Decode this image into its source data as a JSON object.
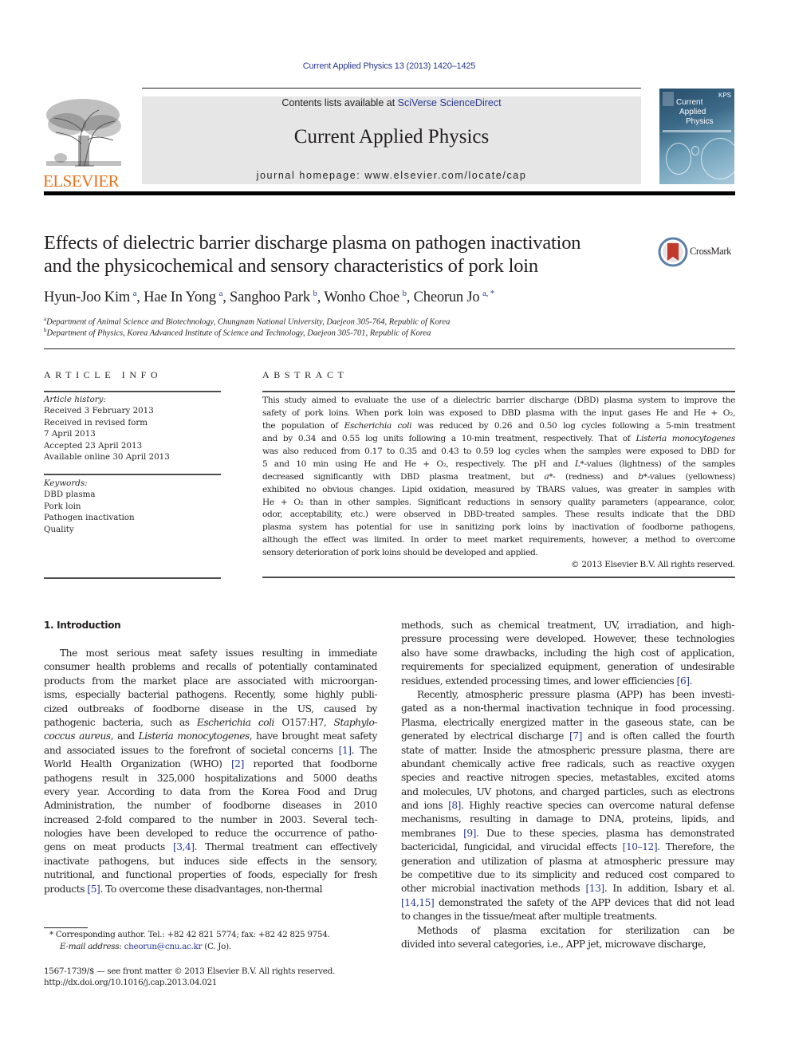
{
  "running_head": "Current Applied Physics 13 (2013) 1420–1425",
  "publisher": {
    "logo_text": "ELSEVIER",
    "logo_icon": "elsevier-tree-icon",
    "brand_color": "#e9711c"
  },
  "banner": {
    "contents_prefix": "Contents lists available at ",
    "contents_link": "SciVerse ScienceDirect",
    "journal_title": "Current Applied Physics",
    "homepage": "journal homepage: www.elsevier.com/locate/cap",
    "background": "#e6e6e6",
    "link_color": "#2b3990"
  },
  "cover": {
    "line1": "Current",
    "line2": "Applied",
    "line3": "Physics",
    "badge": "KPS"
  },
  "article": {
    "title_line1": "Effects of dielectric barrier discharge plasma on pathogen inactivation",
    "title_line2": "and the physicochemical and sensory characteristics of pork loin",
    "crossmark_label": "CrossMark",
    "authors": [
      {
        "name": "Hyun-Joo Kim",
        "sup": "a"
      },
      {
        "name": "Hae In Yong",
        "sup": "a"
      },
      {
        "name": "Sanghoo Park",
        "sup": "b"
      },
      {
        "name": "Wonho Choe",
        "sup": "b"
      },
      {
        "name": "Cheorun Jo",
        "sup": "a, *"
      }
    ],
    "affiliations": [
      {
        "sup": "a",
        "text": "Department of Animal Science and Biotechnology, Chungnam National University, Daejeon 305-764, Republic of Korea"
      },
      {
        "sup": "b",
        "text": "Department of Physics, Korea Advanced Institute of Science and Technology, Daejeon 305-701, Republic of Korea"
      }
    ]
  },
  "article_info": {
    "heading": "ARTICLE INFO",
    "history_label": "Article history:",
    "history": [
      "Received 3 February 2013",
      "Received in revised form",
      "7 April 2013",
      "Accepted 23 April 2013",
      "Available online 30 April 2013"
    ],
    "keywords_label": "Keywords:",
    "keywords": [
      "DBD plasma",
      "Pork loin",
      "Pathogen inactivation",
      "Quality"
    ]
  },
  "abstract": {
    "heading": "ABSTRACT",
    "lines": [
      "This study aimed to evaluate the use of a dielectric barrier discharge (DBD) plasma system to improve the",
      "safety of pork loins. When pork loin was exposed to DBD plasma with the input gases He and He + O₂,",
      "the population of Escherichia coli was reduced by 0.26 and 0.50 log cycles following a 5-min treatment",
      "and by 0.34 and 0.55 log units following a 10-min treatment, respectively. That of Listeria monocytogenes",
      "was also reduced from 0.17 to 0.35 and 0.43 to 0.59 log cycles when the samples were exposed to DBD for",
      "5 and 10 min using He and He + O₂, respectively. The pH and L*-values (lightness) of the samples",
      "decreased significantly with DBD plasma treatment, but a*- (redness) and b*-values (yellowness)",
      "exhibited no obvious changes. Lipid oxidation, measured by TBARS values, was greater in samples with",
      "He + O₂ than in other samples. Significant reductions in sensory quality parameters (appearance, color,",
      "odor, acceptability, etc.) were observed in DBD-treated samples. These results indicate that the DBD",
      "plasma system has potential for use in sanitizing pork loins by inactivation of foodborne pathogens,",
      "although the effect was limited. In order to meet market requirements, however, a method to overcome",
      "sensory deterioration of pork loins should be developed and applied."
    ],
    "copyright": "© 2013 Elsevier B.V. All rights reserved."
  },
  "introduction": {
    "heading": "1.  Introduction",
    "left_column": [
      "The most serious meat safety issues resulting in immediate",
      "consumer health problems and recalls of potentially contaminated",
      "products from the market place are associated with microorgan-",
      "isms, especially bacterial pathogens. Recently, some highly publi-",
      "cized outbreaks of foodborne disease in the US, caused by",
      "pathogenic bacteria, such as Escherichia coli O157:H7, Staphylo-",
      "coccus aureus, and Listeria monocytogenes, have brought meat safety",
      "and associated issues to the forefront of societal concerns [1]. The",
      "World Health Organization (WHO) [2] reported that foodborne",
      "pathogens result in 325,000 hospitalizations and 5000 deaths",
      "every year. According to data from the Korea Food and Drug",
      "Administration, the number of foodborne diseases in 2010",
      "increased 2-fold compared to the number in 2003. Several tech-",
      "nologies have been developed to reduce the occurrence of patho-",
      "gens on meat products [3,4]. Thermal treatment can effectively",
      "inactivate pathogens, but induces side effects in the sensory,",
      "nutritional, and functional properties of foods, especially for fresh",
      "products [5]. To overcome these disadvantages, non-thermal"
    ],
    "right_column": [
      "methods, such as chemical treatment, UV, irradiation, and high-",
      "pressure processing were developed. However, these technologies",
      "also have some drawbacks, including the high cost of application,",
      "requirements for specialized equipment, generation of undesirable",
      "residues, extended processing times, and lower efficiencies [6].",
      "Recently, atmospheric pressure plasma (APP) has been investi-",
      "gated as a non-thermal inactivation technique in food processing.",
      "Plasma, electrically energized matter in the gaseous state, can be",
      "generated by electrical discharge [7] and is often called the fourth",
      "state of matter. Inside the atmospheric pressure plasma, there are",
      "abundant chemically active free radicals, such as reactive oxygen",
      "species and reactive nitrogen species, metastables, excited atoms",
      "and molecules, UV photons, and charged particles, such as electrons",
      "and ions [8]. Highly reactive species can overcome natural defense",
      "mechanisms, resulting in damage to DNA, proteins, lipids, and",
      "membranes [9]. Due to these species, plasma has demonstrated",
      "bactericidal, fungicidal, and virucidal effects [10–12]. Therefore, the",
      "generation and utilization of plasma at atmospheric pressure may",
      "be competitive due to its simplicity and reduced cost compared to",
      "other microbial inactivation methods [13]. In addition, Isbary et al.",
      "[14,15] demonstrated the safety of the APP devices that did not lead",
      "to changes in the tissue/meat after multiple treatments.",
      "Methods of plasma excitation for sterilization can be",
      "divided into several categories, i.e., APP jet, microwave discharge,"
    ]
  },
  "footnotes": {
    "corresponding": "*  Corresponding author. Tel.: +82 42 821 5774; fax: +82 42 825 9754.",
    "email_label": "E-mail address: ",
    "email": "cheorun@cnu.ac.kr",
    "email_suffix": " (C. Jo).",
    "issn": "1567-1739/$ — see front matter © 2013 Elsevier B.V. All rights reserved.",
    "doi": "http://dx.doi.org/10.1016/j.cap.2013.04.021"
  }
}
